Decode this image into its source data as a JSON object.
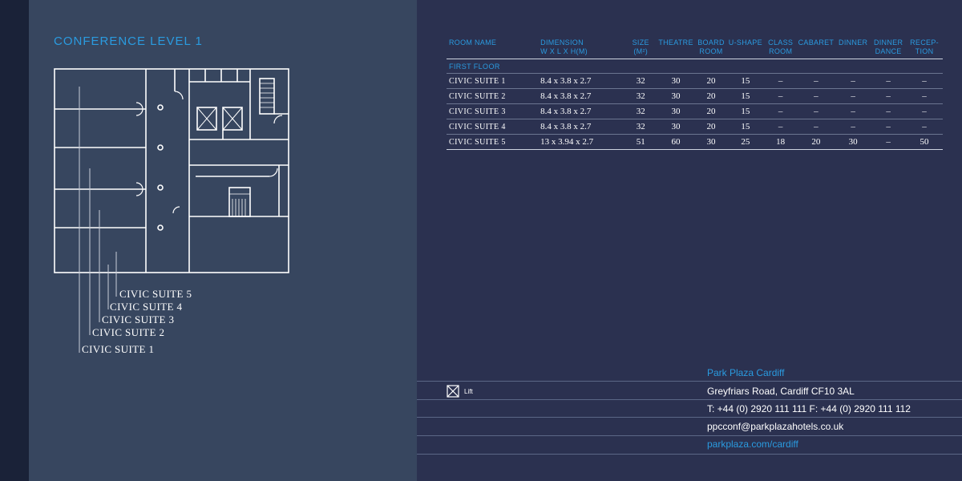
{
  "plan": {
    "title": "CONFERENCE LEVEL 1",
    "suite_labels": [
      "CIVIC SUITE 5",
      "CIVIC SUITE 4",
      "CIVIC SUITE 3",
      "CIVIC SUITE 2",
      "CIVIC SUITE 1"
    ]
  },
  "table": {
    "headers": [
      {
        "line1": "ROOM NAME",
        "line2": ""
      },
      {
        "line1": "DIMENSION",
        "line2": "W X L X H(M)"
      },
      {
        "line1": "SIZE",
        "line2": "(M²)"
      },
      {
        "line1": "THEATRE",
        "line2": ""
      },
      {
        "line1": "BOARD",
        "line2": "ROOM"
      },
      {
        "line1": "U-SHAPE",
        "line2": ""
      },
      {
        "line1": "CLASS",
        "line2": "ROOM"
      },
      {
        "line1": "CABARET",
        "line2": ""
      },
      {
        "line1": "DINNER",
        "line2": ""
      },
      {
        "line1": "DINNER",
        "line2": "DANCE"
      },
      {
        "line1": "RECEP-",
        "line2": "TION"
      }
    ],
    "section": "FIRST FLOOR",
    "rows": [
      [
        "CIVIC SUITE 1",
        "8.4 x 3.8 x 2.7",
        "32",
        "30",
        "20",
        "15",
        "–",
        "–",
        "–",
        "–",
        "–"
      ],
      [
        "CIVIC SUITE 2",
        "8.4 x 3.8 x 2.7",
        "32",
        "30",
        "20",
        "15",
        "–",
        "–",
        "–",
        "–",
        "–"
      ],
      [
        "CIVIC SUITE 3",
        "8.4 x 3.8 x 2.7",
        "32",
        "30",
        "20",
        "15",
        "–",
        "–",
        "–",
        "–",
        "–"
      ],
      [
        "CIVIC SUITE 4",
        "8.4 x 3.8 x 2.7",
        "32",
        "30",
        "20",
        "15",
        "–",
        "–",
        "–",
        "–",
        "–"
      ],
      [
        "CIVIC SUITE 5",
        "13 x 3.94 x 2.7",
        "51",
        "60",
        "30",
        "25",
        "18",
        "20",
        "30",
        "–",
        "50"
      ]
    ]
  },
  "footer": {
    "lift_label": "Lift",
    "hotel_name": "Park Plaza Cardiff",
    "address": "Greyfriars Road, Cardiff CF10 3AL",
    "phone": "T: +44 (0) 2920 111 111   F: +44 (0) 2920 111 112",
    "email": "ppcconf@parkplazahotels.co.uk",
    "website": "parkplaza.com/cardiff"
  },
  "colors": {
    "accent": "#2a9be0",
    "left_panel": "#37465f",
    "right_panel": "#2b3150",
    "spine": "#1a2238"
  }
}
